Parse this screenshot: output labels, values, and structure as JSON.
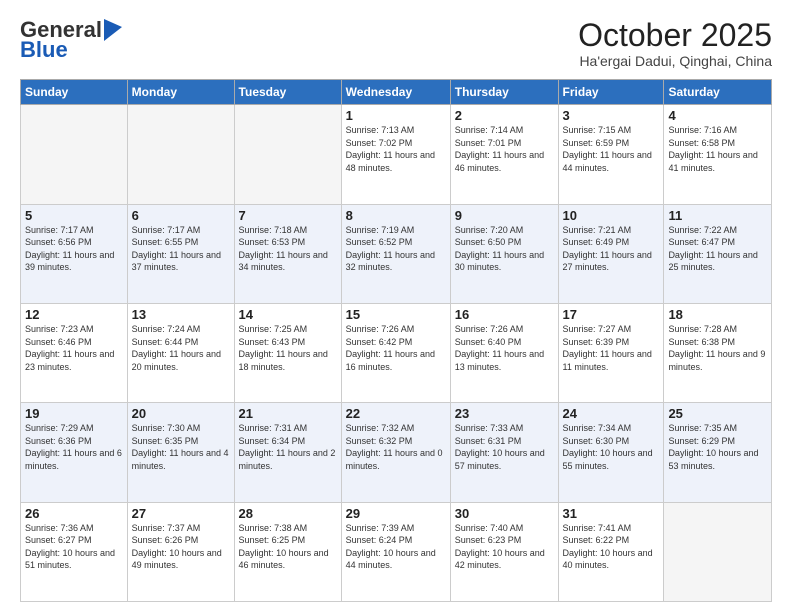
{
  "header": {
    "logo_general": "General",
    "logo_blue": "Blue",
    "month": "October 2025",
    "location": "Ha'ergai Dadui, Qinghai, China"
  },
  "days_of_week": [
    "Sunday",
    "Monday",
    "Tuesday",
    "Wednesday",
    "Thursday",
    "Friday",
    "Saturday"
  ],
  "weeks": [
    [
      {
        "num": "",
        "info": ""
      },
      {
        "num": "",
        "info": ""
      },
      {
        "num": "",
        "info": ""
      },
      {
        "num": "1",
        "info": "Sunrise: 7:13 AM\nSunset: 7:02 PM\nDaylight: 11 hours and 48 minutes."
      },
      {
        "num": "2",
        "info": "Sunrise: 7:14 AM\nSunset: 7:01 PM\nDaylight: 11 hours and 46 minutes."
      },
      {
        "num": "3",
        "info": "Sunrise: 7:15 AM\nSunset: 6:59 PM\nDaylight: 11 hours and 44 minutes."
      },
      {
        "num": "4",
        "info": "Sunrise: 7:16 AM\nSunset: 6:58 PM\nDaylight: 11 hours and 41 minutes."
      }
    ],
    [
      {
        "num": "5",
        "info": "Sunrise: 7:17 AM\nSunset: 6:56 PM\nDaylight: 11 hours and 39 minutes."
      },
      {
        "num": "6",
        "info": "Sunrise: 7:17 AM\nSunset: 6:55 PM\nDaylight: 11 hours and 37 minutes."
      },
      {
        "num": "7",
        "info": "Sunrise: 7:18 AM\nSunset: 6:53 PM\nDaylight: 11 hours and 34 minutes."
      },
      {
        "num": "8",
        "info": "Sunrise: 7:19 AM\nSunset: 6:52 PM\nDaylight: 11 hours and 32 minutes."
      },
      {
        "num": "9",
        "info": "Sunrise: 7:20 AM\nSunset: 6:50 PM\nDaylight: 11 hours and 30 minutes."
      },
      {
        "num": "10",
        "info": "Sunrise: 7:21 AM\nSunset: 6:49 PM\nDaylight: 11 hours and 27 minutes."
      },
      {
        "num": "11",
        "info": "Sunrise: 7:22 AM\nSunset: 6:47 PM\nDaylight: 11 hours and 25 minutes."
      }
    ],
    [
      {
        "num": "12",
        "info": "Sunrise: 7:23 AM\nSunset: 6:46 PM\nDaylight: 11 hours and 23 minutes."
      },
      {
        "num": "13",
        "info": "Sunrise: 7:24 AM\nSunset: 6:44 PM\nDaylight: 11 hours and 20 minutes."
      },
      {
        "num": "14",
        "info": "Sunrise: 7:25 AM\nSunset: 6:43 PM\nDaylight: 11 hours and 18 minutes."
      },
      {
        "num": "15",
        "info": "Sunrise: 7:26 AM\nSunset: 6:42 PM\nDaylight: 11 hours and 16 minutes."
      },
      {
        "num": "16",
        "info": "Sunrise: 7:26 AM\nSunset: 6:40 PM\nDaylight: 11 hours and 13 minutes."
      },
      {
        "num": "17",
        "info": "Sunrise: 7:27 AM\nSunset: 6:39 PM\nDaylight: 11 hours and 11 minutes."
      },
      {
        "num": "18",
        "info": "Sunrise: 7:28 AM\nSunset: 6:38 PM\nDaylight: 11 hours and 9 minutes."
      }
    ],
    [
      {
        "num": "19",
        "info": "Sunrise: 7:29 AM\nSunset: 6:36 PM\nDaylight: 11 hours and 6 minutes."
      },
      {
        "num": "20",
        "info": "Sunrise: 7:30 AM\nSunset: 6:35 PM\nDaylight: 11 hours and 4 minutes."
      },
      {
        "num": "21",
        "info": "Sunrise: 7:31 AM\nSunset: 6:34 PM\nDaylight: 11 hours and 2 minutes."
      },
      {
        "num": "22",
        "info": "Sunrise: 7:32 AM\nSunset: 6:32 PM\nDaylight: 11 hours and 0 minutes."
      },
      {
        "num": "23",
        "info": "Sunrise: 7:33 AM\nSunset: 6:31 PM\nDaylight: 10 hours and 57 minutes."
      },
      {
        "num": "24",
        "info": "Sunrise: 7:34 AM\nSunset: 6:30 PM\nDaylight: 10 hours and 55 minutes."
      },
      {
        "num": "25",
        "info": "Sunrise: 7:35 AM\nSunset: 6:29 PM\nDaylight: 10 hours and 53 minutes."
      }
    ],
    [
      {
        "num": "26",
        "info": "Sunrise: 7:36 AM\nSunset: 6:27 PM\nDaylight: 10 hours and 51 minutes."
      },
      {
        "num": "27",
        "info": "Sunrise: 7:37 AM\nSunset: 6:26 PM\nDaylight: 10 hours and 49 minutes."
      },
      {
        "num": "28",
        "info": "Sunrise: 7:38 AM\nSunset: 6:25 PM\nDaylight: 10 hours and 46 minutes."
      },
      {
        "num": "29",
        "info": "Sunrise: 7:39 AM\nSunset: 6:24 PM\nDaylight: 10 hours and 44 minutes."
      },
      {
        "num": "30",
        "info": "Sunrise: 7:40 AM\nSunset: 6:23 PM\nDaylight: 10 hours and 42 minutes."
      },
      {
        "num": "31",
        "info": "Sunrise: 7:41 AM\nSunset: 6:22 PM\nDaylight: 10 hours and 40 minutes."
      },
      {
        "num": "",
        "info": ""
      }
    ]
  ]
}
